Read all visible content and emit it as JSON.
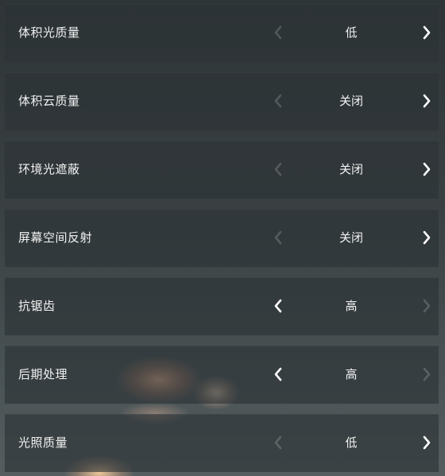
{
  "settings": [
    {
      "label": "体积光质量",
      "value": "低",
      "left_enabled": false,
      "right_enabled": true
    },
    {
      "label": "体积云质量",
      "value": "关闭",
      "left_enabled": false,
      "right_enabled": true
    },
    {
      "label": "环境光遮蔽",
      "value": "关闭",
      "left_enabled": false,
      "right_enabled": true
    },
    {
      "label": "屏幕空间反射",
      "value": "关闭",
      "left_enabled": false,
      "right_enabled": true
    },
    {
      "label": "抗锯齿",
      "value": "高",
      "left_enabled": true,
      "right_enabled": false
    },
    {
      "label": "后期处理",
      "value": "高",
      "left_enabled": true,
      "right_enabled": false
    },
    {
      "label": "光照质量",
      "value": "低",
      "left_enabled": false,
      "right_enabled": true
    }
  ],
  "icons": {
    "left": "chevron-left-icon",
    "right": "chevron-right-icon"
  },
  "colors": {
    "text": "#f2f2f2",
    "arrow_enabled": "#ffffff",
    "arrow_disabled": "rgba(255,255,255,0.18)",
    "row_background": "rgba(44,50,53,0.62)"
  }
}
